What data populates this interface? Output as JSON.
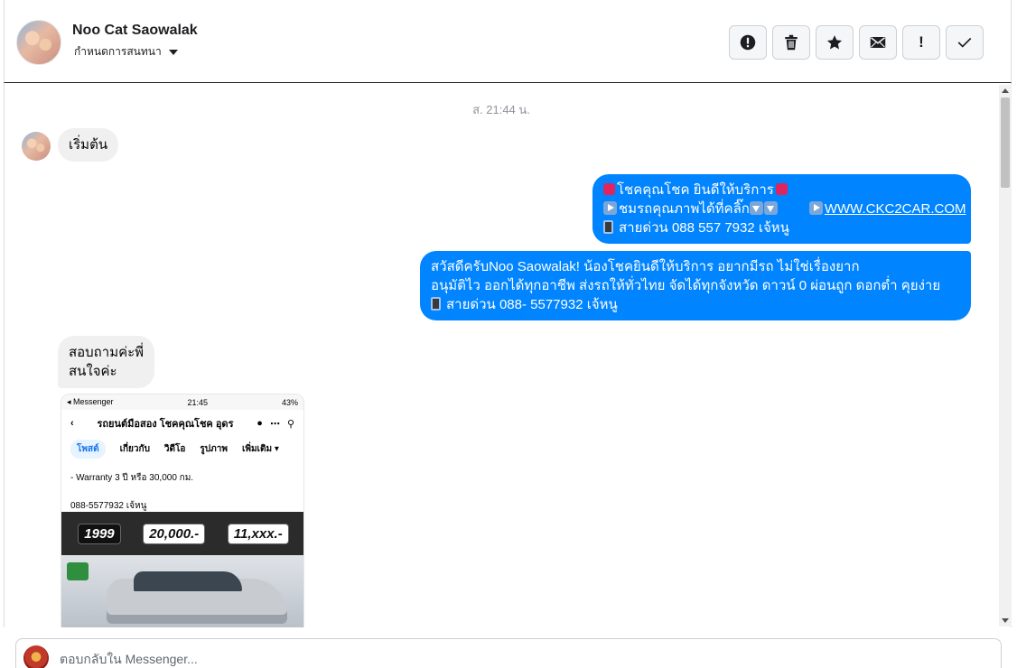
{
  "header": {
    "contact_name": "Noo Cat Saowalak",
    "conversation_settings": "กำหนดการสนทนา",
    "actions": [
      {
        "name": "mark-spam-button",
        "icon": "exclamation-circle-icon"
      },
      {
        "name": "delete-button",
        "icon": "trash-icon"
      },
      {
        "name": "star-button",
        "icon": "star-icon"
      },
      {
        "name": "mark-unread-button",
        "icon": "envelope-icon"
      },
      {
        "name": "follow-up-button",
        "icon": "exclamation-icon",
        "glyph": "!"
      },
      {
        "name": "mark-done-button",
        "icon": "checkmark-icon"
      }
    ]
  },
  "thread": {
    "timestamp": "ส. 21:44 น.",
    "messages": [
      {
        "from": "contact",
        "text": "เริ่มต้น"
      },
      {
        "from": "page",
        "lines": [
          "โชคคุณโชค ยินดีให้บริการ",
          "ชมรถคุณภาพได้ที่คลิ๊ก",
          "WWW.CKC2CAR.COM",
          "สายด่วน 088 557 7932 เจ้หนู"
        ]
      },
      {
        "from": "page",
        "lines": [
          "สวัสดีครับNoo Saowalak! น้องโชคยินดีให้บริการ อยากมีรถ ไม่ใช่เรื่องยาก",
          "อนุมัติไว ออกได้ทุกอาชีพ ส่งรถให้ทั่วไทย จัดได้ทุกจังหวัด ดาวน์ 0  ผ่อนถูก ดอกต่ำ คุยง่าย",
          "สายด่วน 088- 5577932 เจ้หนู"
        ]
      },
      {
        "from": "contact",
        "lines": [
          "สอบถามค่ะพี่",
          "สนใจค่ะ"
        ]
      }
    ],
    "attachment": {
      "status_left": "◂ Messenger",
      "status_time": "21:45",
      "status_right": "43%",
      "page_title": "รถยนต์มือสอง โชคคุณโชค อุดร",
      "tabs": [
        "โพสต์",
        "เกี่ยวกับ",
        "วิดีโอ",
        "รูปภาพ",
        "เพิ่มเติม ▾"
      ],
      "warranty_text": "- Warranty 3 ปี หรือ 30,000 กม.",
      "phone_text": "088-5577932 เจ้หนู",
      "price_cells": [
        "1999",
        "20,000.-",
        "11,xxx.-"
      ]
    }
  },
  "composer": {
    "placeholder": "ตอบกลับใน Messenger..."
  },
  "colors": {
    "outgoing_bubble": "#0084ff",
    "incoming_bubble": "#f0f0f0",
    "timestamp": "#90949c"
  }
}
